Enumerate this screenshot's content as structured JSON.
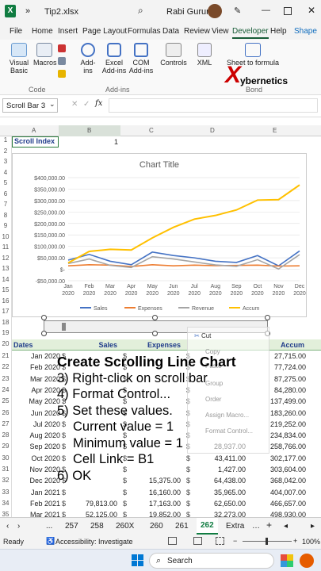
{
  "window": {
    "title": "Tip2.xlsx",
    "user": "Rabi Gurung",
    "autosave": "»"
  },
  "ribbon_tabs": [
    "File",
    "Home",
    "Insert",
    "Page Layout",
    "Formulas",
    "Data",
    "Review",
    "View",
    "Developer",
    "Help",
    "Shape"
  ],
  "ribbon": {
    "visual_basic": "Visual Basic",
    "macros": "Macros",
    "code_group": "Code",
    "add_ins": "Add-ins",
    "excel_add_ins": "Excel Add-ins",
    "com_add_ins": "COM Add-ins",
    "addins_group": "Add-ins",
    "controls": "Controls",
    "xml": "XML",
    "sheet_formula": "Sheet to formula",
    "bond_group": "Bond",
    "brand": "ybernetics",
    "brand_x": "X"
  },
  "formula_bar": {
    "name_box": "Scroll Bar 3",
    "fx": "fx"
  },
  "columns": [
    "A",
    "B",
    "C",
    "D",
    "E"
  ],
  "cells": {
    "a1": "Scroll Index",
    "b1": "1",
    "a20": "Dates",
    "b20": "Sales",
    "c20": "Expenses",
    "d20": "",
    "e20": "Accum"
  },
  "rows_above": [
    "1",
    "2",
    "3",
    "4",
    "5",
    "6",
    "7",
    "8",
    "9",
    "10",
    "11",
    "12",
    "13",
    "14",
    "15",
    "16",
    "17",
    "18",
    "19",
    "20"
  ],
  "data_rows": [
    {
      "n": "21",
      "date": "Jan 2020",
      "sales": "",
      "exp": "",
      "rev": "",
      "accum": "27,715.00"
    },
    {
      "n": "22",
      "date": "Feb 2020",
      "sales": "",
      "exp": "",
      "rev": "",
      "accum": "77,724.00"
    },
    {
      "n": "23",
      "date": "Mar 2020",
      "sales": "",
      "exp": "",
      "rev": "",
      "accum": "87,275.00"
    },
    {
      "n": "24",
      "date": "Apr 2020",
      "sales": "",
      "exp": "",
      "rev": "",
      "accum": "84,280.00"
    },
    {
      "n": "25",
      "date": "May 2020",
      "sales": "",
      "exp": "",
      "rev": "",
      "accum": "137,499.00"
    },
    {
      "n": "26",
      "date": "Jun 2020",
      "sales": "",
      "exp": "",
      "rev": "",
      "accum": "183,260.00"
    },
    {
      "n": "27",
      "date": "Jul 2020",
      "sales": "",
      "exp": "",
      "rev": "",
      "accum": "219,252.00"
    },
    {
      "n": "28",
      "date": "Aug 2020",
      "sales": "",
      "exp": "",
      "rev": "",
      "accum": "234,834.00"
    },
    {
      "n": "29",
      "date": "Sep 2020",
      "sales": "",
      "exp": "",
      "rev": "28,937.00",
      "accum": "258,766.00"
    },
    {
      "n": "30",
      "date": "Oct 2020",
      "sales": "",
      "exp": "",
      "rev": "43,411.00",
      "accum": "302,177.00"
    },
    {
      "n": "31",
      "date": "Nov 2020",
      "sales": "",
      "exp": "",
      "rev": "1,427.00",
      "accum": "303,604.00"
    },
    {
      "n": "32",
      "date": "Dec 2020",
      "sales": "",
      "exp": "15,375.00",
      "rev": "64,438.00",
      "accum": "368,042.00"
    },
    {
      "n": "33",
      "date": "Jan 2021",
      "sales": "",
      "exp": "16,160.00",
      "rev": "35,965.00",
      "accum": "404,007.00"
    },
    {
      "n": "34",
      "date": "Feb 2021",
      "sales": "79,813.00",
      "exp": "17,163.00",
      "rev": "62,650.00",
      "accum": "466,657.00"
    },
    {
      "n": "35",
      "date": "Feb 2021",
      "sales": "79,813.00",
      "exp": "17,163.00",
      "rev": "62,650.00",
      "accum": "466,657.00"
    },
    {
      "n": "35",
      "date": "Mar 2021",
      "sales": "52,125.00",
      "exp": "19,852.00",
      "rev": "32,273.00",
      "accum": "498,930.00"
    },
    {
      "n": "36",
      "date": "Apr 2021",
      "sales": "40,110.00",
      "exp": "15,180.00",
      "rev": "24,930.00",
      "accum": "523,860.00"
    }
  ],
  "context_menu": [
    "Cut",
    "Copy",
    "Paste",
    "Group",
    "Order",
    "Assign Macro...",
    "Format Control..."
  ],
  "overlay": {
    "title": "Create Scrolling Line Chart",
    "l1": "3) Right-click on scroll bar",
    "l2": "4) Format Control...",
    "l3": "5) Set these values.",
    "l4": "Current value = 1",
    "l5": "Minimum value = 1",
    "l6": "Cell Link = B1",
    "l7": "6) OK"
  },
  "sheet_tabs": [
    "...",
    "257",
    "258",
    "260X",
    "260",
    "261",
    "262",
    "Extra"
  ],
  "active_sheet": "262",
  "status": {
    "ready": "Ready",
    "accessibility": "Accessibility: Investigate",
    "zoom": "100%"
  },
  "taskbar": {
    "search": "Search"
  },
  "chart_data": {
    "type": "line",
    "title": "Chart Title",
    "categories": [
      "Jan 2020",
      "Feb 2020",
      "Mar 2020",
      "Apr 2020",
      "May 2020",
      "Jun 2020",
      "Jul 2020",
      "Aug 2020",
      "Sep 2020",
      "Oct 2020",
      "Nov 2020",
      "Dec 2020"
    ],
    "yticks": [
      "$400,000.00",
      "$350,000.00",
      "$300,000.00",
      "$250,000.00",
      "$200,000.00",
      "$150,000.00",
      "$100,000.00",
      "$50,000.00",
      "$-",
      "-$50,000.00"
    ],
    "ylim": [
      -50000,
      400000
    ],
    "series": [
      {
        "name": "Sales",
        "color": "#4472c4",
        "values": [
          40000,
          65000,
          35000,
          20000,
          75000,
          60000,
          50000,
          35000,
          30000,
          60000,
          15000,
          80000
        ]
      },
      {
        "name": "Expenses",
        "color": "#ed7d31",
        "values": [
          15000,
          20000,
          18000,
          12000,
          20000,
          15000,
          18000,
          16000,
          17000,
          18000,
          14000,
          15000
        ]
      },
      {
        "name": "Revenue",
        "color": "#a5a5a5",
        "values": [
          25000,
          45000,
          17000,
          8000,
          55000,
          45000,
          32000,
          19000,
          13000,
          42000,
          1000,
          64000
        ]
      },
      {
        "name": "Accum",
        "color": "#ffc000",
        "values": [
          28000,
          78000,
          87000,
          84000,
          137000,
          183000,
          219000,
          235000,
          259000,
          302000,
          304000,
          368000
        ]
      }
    ],
    "legend": "bottom",
    "grid": true
  }
}
